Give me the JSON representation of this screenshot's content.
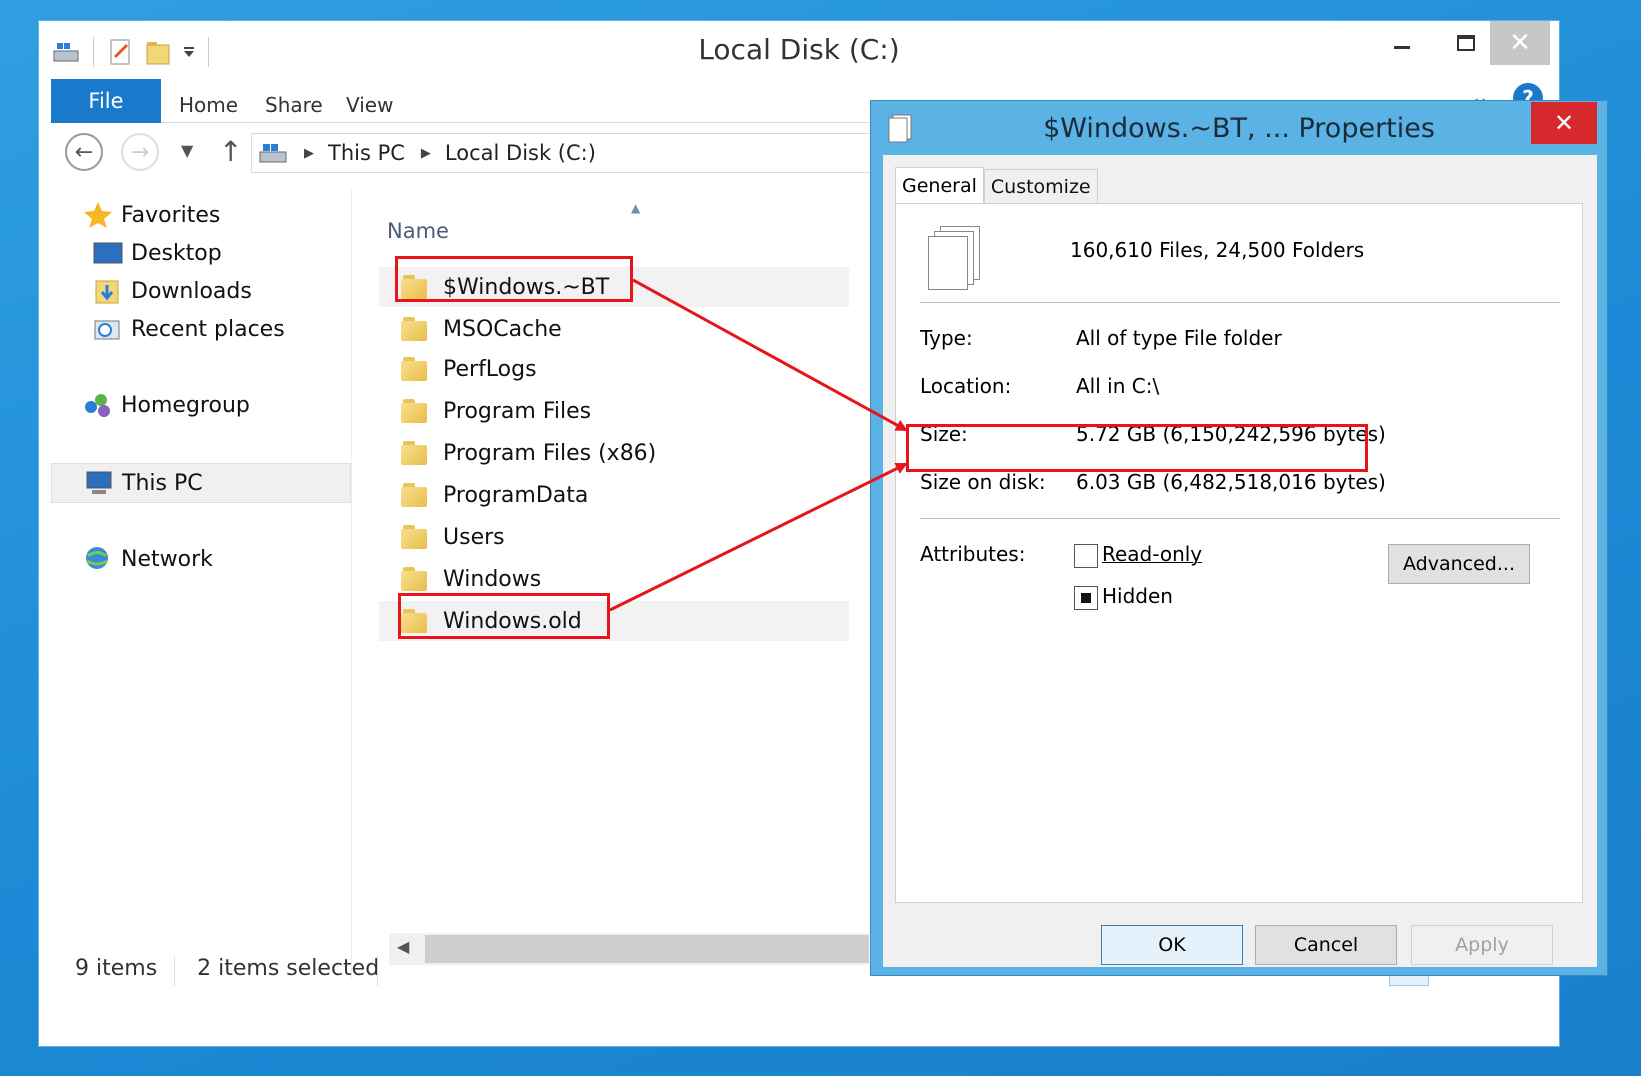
{
  "explorer": {
    "title": "Local Disk (C:)",
    "ribbon": {
      "file": "File",
      "home": "Home",
      "share": "Share",
      "view": "View",
      "help": "?"
    },
    "address": {
      "crumbs": [
        "This PC",
        "Local Disk (C:)"
      ]
    },
    "nav_pane": {
      "favorites": "Favorites",
      "desktop": "Desktop",
      "downloads": "Downloads",
      "recent": "Recent places",
      "homegroup": "Homegroup",
      "this_pc": "This PC",
      "network": "Network"
    },
    "column_name": "Name",
    "files": [
      "$Windows.~BT",
      "MSOCache",
      "PerfLogs",
      "Program Files",
      "Program Files (x86)",
      "ProgramData",
      "Users",
      "Windows",
      "Windows.old"
    ],
    "status": {
      "count": "9 items",
      "selected": "2 items selected"
    }
  },
  "dialog": {
    "title": "$Windows.~BT, ... Properties",
    "tabs": [
      "General",
      "Customize"
    ],
    "summary": "160,610 Files, 24,500 Folders",
    "props": {
      "type_label": "Type:",
      "type_value": "All of type File folder",
      "location_label": "Location:",
      "location_value": "All in C:\\",
      "size_label": "Size:",
      "size_value": "5.72 GB (6,150,242,596 bytes)",
      "disk_label": "Size on disk:",
      "disk_value": "6.03 GB (6,482,518,016 bytes)",
      "attributes_label": "Attributes:"
    },
    "attributes": {
      "readonly": "Read-only",
      "hidden": "Hidden"
    },
    "advanced": "Advanced...",
    "buttons": {
      "ok": "OK",
      "cancel": "Cancel",
      "apply": "Apply"
    }
  },
  "colors": {
    "highlight": "#e8141b",
    "file_tab": "#1979ca",
    "dialog_frame": "#5bb3e5",
    "close_button": "#d7282e"
  }
}
